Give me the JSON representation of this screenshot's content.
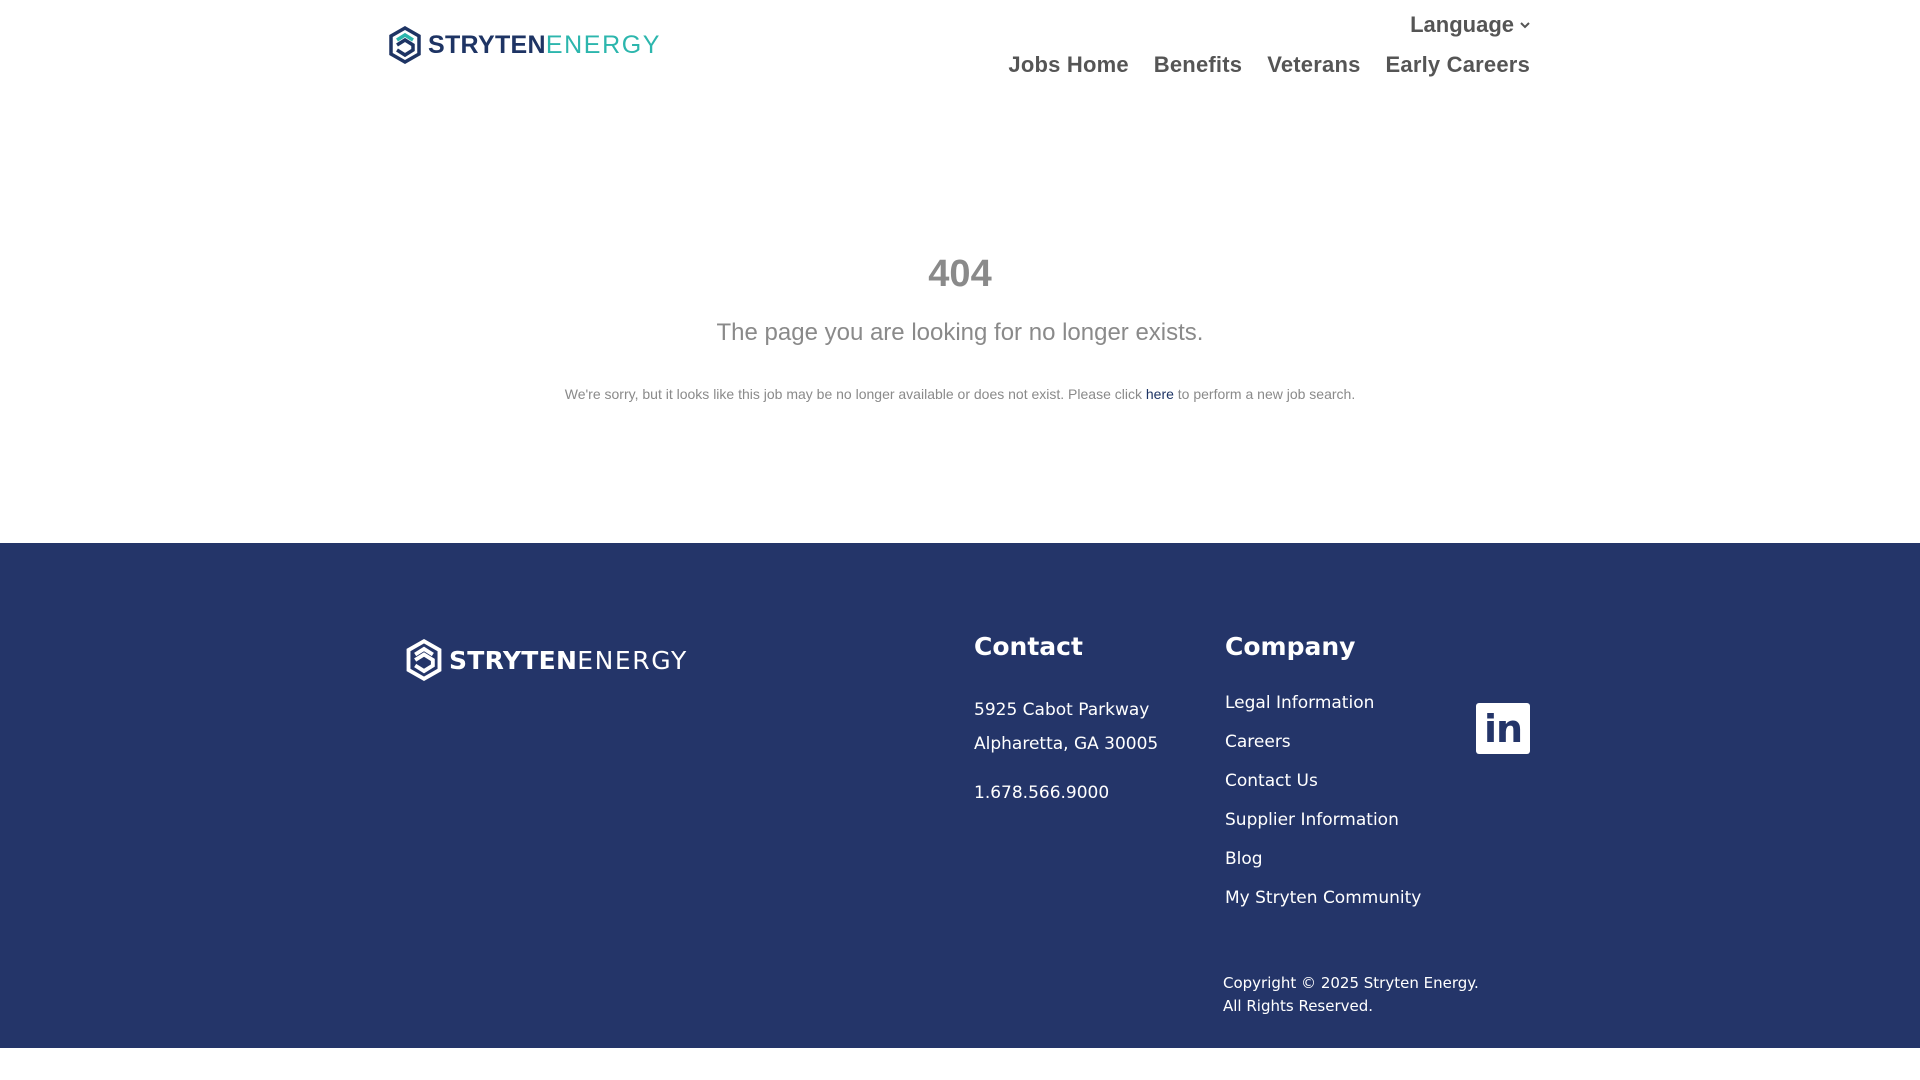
{
  "header": {
    "logo": {
      "bold": "STRYTEN",
      "light": "ENERGY"
    },
    "language_label": "Language",
    "nav": [
      "Jobs Home",
      "Benefits",
      "Veterans",
      "Early Careers"
    ]
  },
  "main": {
    "code": "404",
    "title": "The page you are looking for no longer exists.",
    "message_before": "We're sorry, but it looks like this job may be no longer available or does not exist. Please click ",
    "link_text": "here",
    "message_after": " to perform a new job search."
  },
  "footer": {
    "logo": {
      "bold": "STRYTEN",
      "light": "ENERGY"
    },
    "contact": {
      "heading": "Contact",
      "address_line1": "5925 Cabot Parkway",
      "address_line2": "Alpharetta, GA 30005",
      "phone": "1.678.566.9000"
    },
    "company": {
      "heading": "Company",
      "links": [
        "Legal Information",
        "Careers",
        "Contact Us",
        "Supplier Information",
        "Blog",
        "My Stryten Community"
      ]
    },
    "social": {
      "icon": "linkedin-icon",
      "label": "in"
    },
    "copyright_line1": "Copyright © 2025 Stryten Energy.",
    "copyright_line2": "All Rights Reserved."
  },
  "colors": {
    "brand_navy": "#1e3464",
    "brand_teal": "#2cb6ad",
    "footer_bg": "#243569",
    "nav_text": "#555555",
    "muted_text": "#8a8a8a"
  }
}
